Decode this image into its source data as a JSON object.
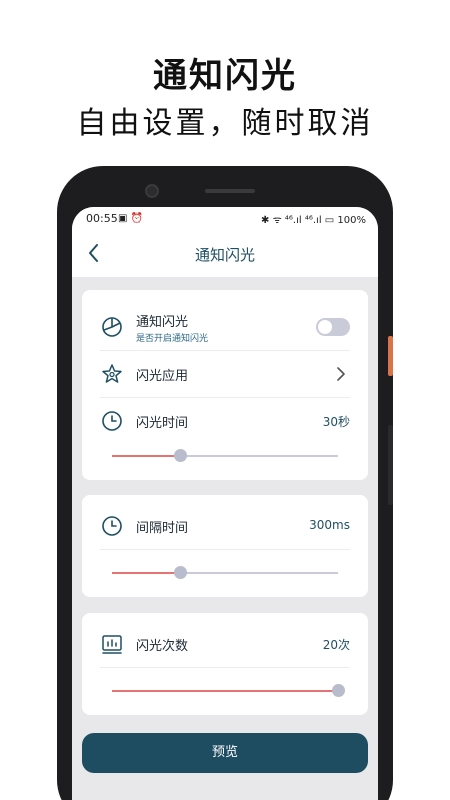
{
  "promo": {
    "title": "通知闪光",
    "subtitle": "自由设置，随时取消"
  },
  "statusbar": {
    "time": "00:55",
    "left_icons": "▣ ⏰",
    "right_text": "✱ ᯤ ⁴⁶.ıl ⁴⁶.ıl ▭ 100%"
  },
  "nav": {
    "title": "通知闪光"
  },
  "card1": {
    "notify": {
      "label": "通知闪光",
      "sub": "是否开启通知闪光",
      "enabled": false
    },
    "apps": {
      "label": "闪光应用"
    },
    "duration": {
      "label": "闪光时间",
      "value": "30秒",
      "slider_fraction": 0.3
    }
  },
  "card2": {
    "interval": {
      "label": "间隔时间",
      "value": "300ms",
      "slider_fraction": 0.3
    }
  },
  "card3": {
    "count": {
      "label": "闪光次数",
      "value": "20次",
      "slider_fraction": 1.0
    }
  },
  "preview": {
    "label": "预览"
  },
  "colors": {
    "accent": "#1e4c60",
    "slider_fill": "#e57373",
    "slider_track": "#c9cbd8",
    "label_text": "#1f4f63"
  }
}
